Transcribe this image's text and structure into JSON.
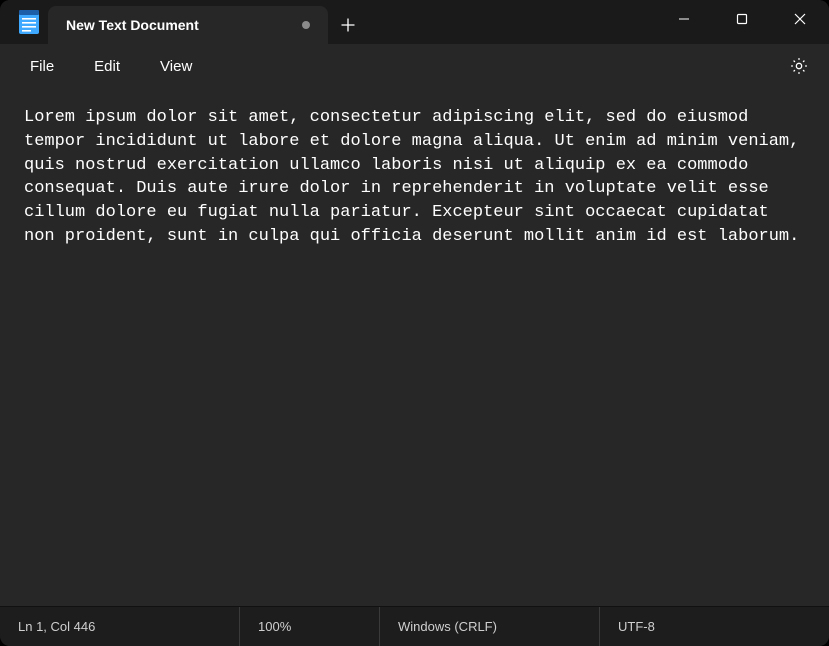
{
  "tab": {
    "title": "New Text Document",
    "modified": true
  },
  "menus": {
    "file": "File",
    "edit": "Edit",
    "view": "View"
  },
  "editor": {
    "content": "Lorem ipsum dolor sit amet, consectetur adipiscing elit, sed do eiusmod tempor incididunt ut labore et dolore magna aliqua. Ut enim ad minim veniam, quis nostrud exercitation ullamco laboris nisi ut aliquip ex ea commodo consequat. Duis aute irure dolor in reprehenderit in voluptate velit esse cillum dolore eu fugiat nulla pariatur. Excepteur sint occaecat cupidatat non proident, sunt in culpa qui officia deserunt mollit anim id est laborum."
  },
  "status": {
    "position": "Ln 1, Col 446",
    "zoom": "100%",
    "line_ending": "Windows (CRLF)",
    "encoding": "UTF-8"
  }
}
